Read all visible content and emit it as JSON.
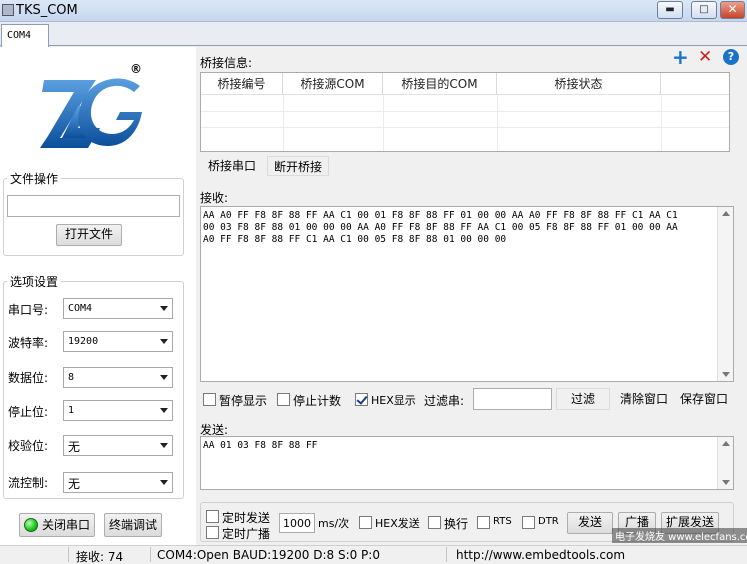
{
  "window": {
    "title": "TKS_COM",
    "min_glyph": "▬",
    "max_glyph": "□",
    "close_glyph": "✕"
  },
  "tabs": [
    {
      "label": "COM4"
    }
  ],
  "logo": {
    "text": "ZLG",
    "registered": "®"
  },
  "file_ops": {
    "title": "文件操作",
    "path_value": "",
    "open_button": "打开文件"
  },
  "options": {
    "title": "选项设置",
    "rows": [
      {
        "label": "串口号:",
        "value": "COM4"
      },
      {
        "label": "波特率:",
        "value": "19200"
      },
      {
        "label": "数据位:",
        "value": "8"
      },
      {
        "label": "停止位:",
        "value": "1"
      },
      {
        "label": "校验位:",
        "value": "无"
      },
      {
        "label": "流控制:",
        "value": "无"
      }
    ]
  },
  "left_buttons": {
    "close_port": "关闭串口",
    "terminal_debug": "终端调试"
  },
  "bridge": {
    "title": "桥接信息:",
    "columns": [
      "桥接编号",
      "桥接源COM",
      "桥接目的COM",
      "桥接状态"
    ],
    "bridge_button": "桥接串口",
    "disconnect_button": "断开桥接"
  },
  "toolbar_icons": {
    "add": "+",
    "delete": "✕",
    "help": "?"
  },
  "icon_colors": {
    "add": "#1a73c8",
    "delete": "#cc2222",
    "help": "#1a73c8",
    "led_on": "#22cc22"
  },
  "receive": {
    "label": "接收:",
    "lines": [
      "AA A0 FF F8 8F 88 FF AA C1 00 01 F8 8F 88 FF 01 00 00 AA A0 FF F8 8F 88 FF C1 AA C1",
      "00 03 F8 8F 88 01 00 00 00 AA A0 FF F8 8F 88 FF AA C1 00 05 F8 8F 88 FF 01 00 00 AA",
      "A0 FF F8 8F 88 FF C1 AA C1 00 05 F8 8F 88 01 00 00 00"
    ]
  },
  "receive_controls": {
    "pause": {
      "label": "暂停显示",
      "checked": false
    },
    "stop_count": {
      "label": "停止计数",
      "checked": false
    },
    "hex_display": {
      "label": "HEX显示",
      "checked": true
    },
    "filter_label": "过滤串:",
    "filter_value": "",
    "filter_button": "过滤",
    "clear_button": "清除窗口",
    "save_button": "保存窗口"
  },
  "send": {
    "label": "发送:",
    "text": "AA 01 03 F8 8F 88 FF"
  },
  "send_controls": {
    "timed_send": {
      "label": "定时发送",
      "checked": false
    },
    "timed_broadcast": {
      "label": "定时广播",
      "checked": false
    },
    "interval_value": "1000",
    "interval_unit": "ms/次",
    "hex_send": {
      "label": "HEX发送",
      "checked": false
    },
    "newline": {
      "label": "换行",
      "checked": false
    },
    "rts": {
      "label": "RTS",
      "checked": false
    },
    "dtr": {
      "label": "DTR",
      "checked": false
    },
    "send_button": "发送",
    "broadcast_button": "广播",
    "ext_send_button": "扩展发送"
  },
  "status": {
    "receive_count": "接收: 74",
    "port_info": "COM4:Open BAUD:19200 D:8 S:0 P:0",
    "url": "http://www.embedtools.com",
    "watermark": "电子发烧友 www.elecfans.com"
  }
}
